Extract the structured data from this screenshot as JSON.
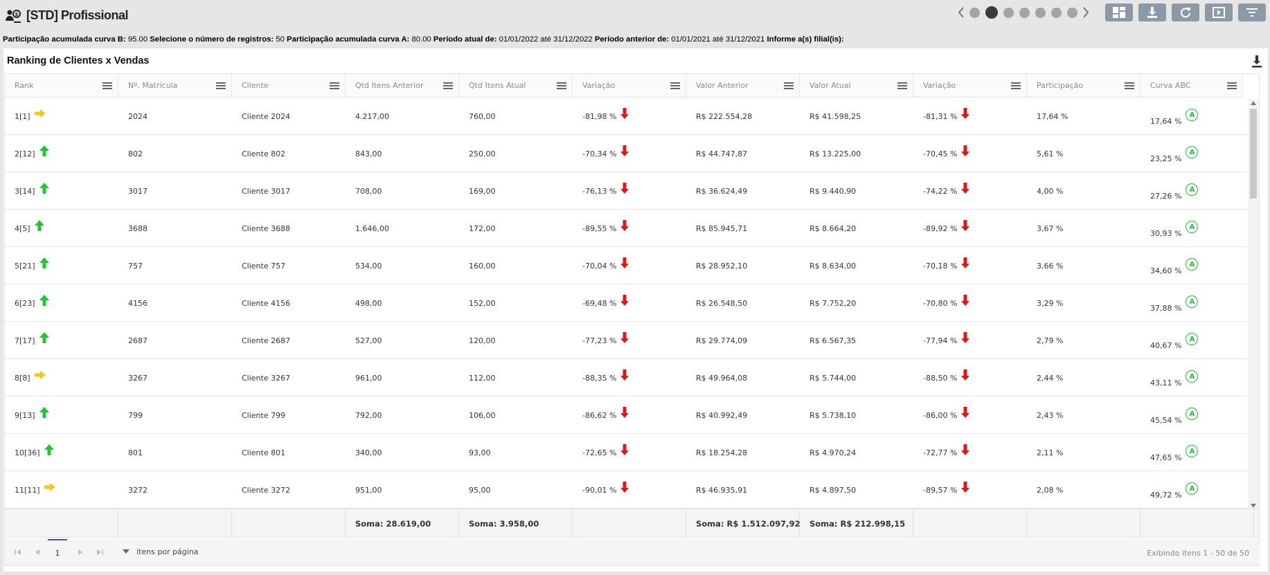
{
  "app": {
    "title": "[STD] Profissional"
  },
  "params": {
    "curva_b_label": "Participação acumulada curva B:",
    "curva_b_value": "95.00",
    "num_reg_label": "Selecione o número de registros:",
    "num_reg_value": "50",
    "curva_a_label": "Participação acumulada curva A:",
    "curva_a_value": "80.00",
    "periodo_atual_label": "Período atual de:",
    "periodo_atual_value": "01/01/2022 até 31/12/2022",
    "periodo_anterior_label": "Período anterior de:",
    "periodo_anterior_value": "01/01/2021 até 31/12/2021",
    "filial_label": "Informe a(s) filial(is):"
  },
  "panel": {
    "title": "Ranking de Clientes x Vendas"
  },
  "columns": [
    "Rank",
    "Nº. Matrícula",
    "Cliente",
    "Qtd Itens Anterior",
    "Qtd Itens Atual",
    "Variação",
    "Valor Anterior",
    "Valor Atual",
    "Variação",
    "Participação",
    "Curva ABC"
  ],
  "colors": {
    "up": "#1ec733",
    "neutral": "#f5c518",
    "down": "#e01616",
    "curve_a": "#22c032"
  },
  "rows": [
    {
      "rank": "1[1]",
      "trend": "neutral",
      "mat": "2024",
      "cliente": "Cliente 2024",
      "qtd_ant": "4.217,00",
      "qtd_atu": "760,00",
      "var1": "-81,98 %",
      "val_ant": "R$ 222.554,28",
      "val_atu": "R$ 41.598,25",
      "var2": "-81,31 %",
      "part": "17,64 %",
      "acum": "17,64 %",
      "curva": "A"
    },
    {
      "rank": "2[12]",
      "trend": "up",
      "mat": "802",
      "cliente": "Cliente 802",
      "qtd_ant": "843,00",
      "qtd_atu": "250,00",
      "var1": "-70,34 %",
      "val_ant": "R$ 44.747,87",
      "val_atu": "R$ 13.225,00",
      "var2": "-70,45 %",
      "part": "5,61 %",
      "acum": "23,25 %",
      "curva": "A"
    },
    {
      "rank": "3[14]",
      "trend": "up",
      "mat": "3017",
      "cliente": "Cliente 3017",
      "qtd_ant": "708,00",
      "qtd_atu": "169,00",
      "var1": "-76,13 %",
      "val_ant": "R$ 36.624,49",
      "val_atu": "R$ 9.440,90",
      "var2": "-74,22 %",
      "part": "4,00 %",
      "acum": "27,26 %",
      "curva": "A"
    },
    {
      "rank": "4[5]",
      "trend": "up",
      "mat": "3688",
      "cliente": "Cliente 3688",
      "qtd_ant": "1.646,00",
      "qtd_atu": "172,00",
      "var1": "-89,55 %",
      "val_ant": "R$ 85.945,71",
      "val_atu": "R$ 8.664,20",
      "var2": "-89,92 %",
      "part": "3,67 %",
      "acum": "30,93 %",
      "curva": "A"
    },
    {
      "rank": "5[21]",
      "trend": "up",
      "mat": "757",
      "cliente": "Cliente 757",
      "qtd_ant": "534,00",
      "qtd_atu": "160,00",
      "var1": "-70,04 %",
      "val_ant": "R$ 28.952,10",
      "val_atu": "R$ 8.634,00",
      "var2": "-70,18 %",
      "part": "3,66 %",
      "acum": "34,60 %",
      "curva": "A"
    },
    {
      "rank": "6[23]",
      "trend": "up",
      "mat": "4156",
      "cliente": "Cliente 4156",
      "qtd_ant": "498,00",
      "qtd_atu": "152,00",
      "var1": "-69,48 %",
      "val_ant": "R$ 26.548,50",
      "val_atu": "R$ 7.752,20",
      "var2": "-70,80 %",
      "part": "3,29 %",
      "acum": "37,88 %",
      "curva": "A"
    },
    {
      "rank": "7[17]",
      "trend": "up",
      "mat": "2687",
      "cliente": "Cliente 2687",
      "qtd_ant": "527,00",
      "qtd_atu": "120,00",
      "var1": "-77,23 %",
      "val_ant": "R$ 29.774,09",
      "val_atu": "R$ 6.567,35",
      "var2": "-77,94 %",
      "part": "2,79 %",
      "acum": "40,67 %",
      "curva": "A"
    },
    {
      "rank": "8[8]",
      "trend": "neutral",
      "mat": "3267",
      "cliente": "Cliente 3267",
      "qtd_ant": "961,00",
      "qtd_atu": "112,00",
      "var1": "-88,35 %",
      "val_ant": "R$ 49.964,08",
      "val_atu": "R$ 5.744,00",
      "var2": "-88,50 %",
      "part": "2,44 %",
      "acum": "43,11 %",
      "curva": "A"
    },
    {
      "rank": "9[13]",
      "trend": "up",
      "mat": "799",
      "cliente": "Cliente 799",
      "qtd_ant": "792,00",
      "qtd_atu": "106,00",
      "var1": "-86,62 %",
      "val_ant": "R$ 40.992,49",
      "val_atu": "R$ 5.738,10",
      "var2": "-86,00 %",
      "part": "2,43 %",
      "acum": "45,54 %",
      "curva": "A"
    },
    {
      "rank": "10[36]",
      "trend": "up",
      "mat": "801",
      "cliente": "Cliente 801",
      "qtd_ant": "340,00",
      "qtd_atu": "93,00",
      "var1": "-72,65 %",
      "val_ant": "R$ 18.254,28",
      "val_atu": "R$ 4.970,24",
      "var2": "-72,77 %",
      "part": "2,11 %",
      "acum": "47,65 %",
      "curva": "A"
    },
    {
      "rank": "11[11]",
      "trend": "neutral",
      "mat": "3272",
      "cliente": "Cliente 3272",
      "qtd_ant": "951,00",
      "qtd_atu": "95,00",
      "var1": "-90,01 %",
      "val_ant": "R$ 46.935,91",
      "val_atu": "R$ 4.897,50",
      "var2": "-89,57 %",
      "part": "2,08 %",
      "acum": "49,72 %",
      "curva": "A"
    }
  ],
  "totals": {
    "qtd_ant": "Soma: 28.619,00",
    "qtd_atu": "Soma: 3.958,00",
    "val_ant": "Soma: R$ 1.512.097,92",
    "val_atu": "Soma: R$ 212.998,15"
  },
  "pager": {
    "current_page": "1",
    "page_size_label": "itens por página",
    "info": "Exibindo itens 1 - 50 de 50"
  },
  "icons": {
    "logo": "users-money-icon",
    "toolbar": [
      "dashboard-icon",
      "download-icon",
      "refresh-icon",
      "play-icon",
      "filter-icon"
    ]
  }
}
